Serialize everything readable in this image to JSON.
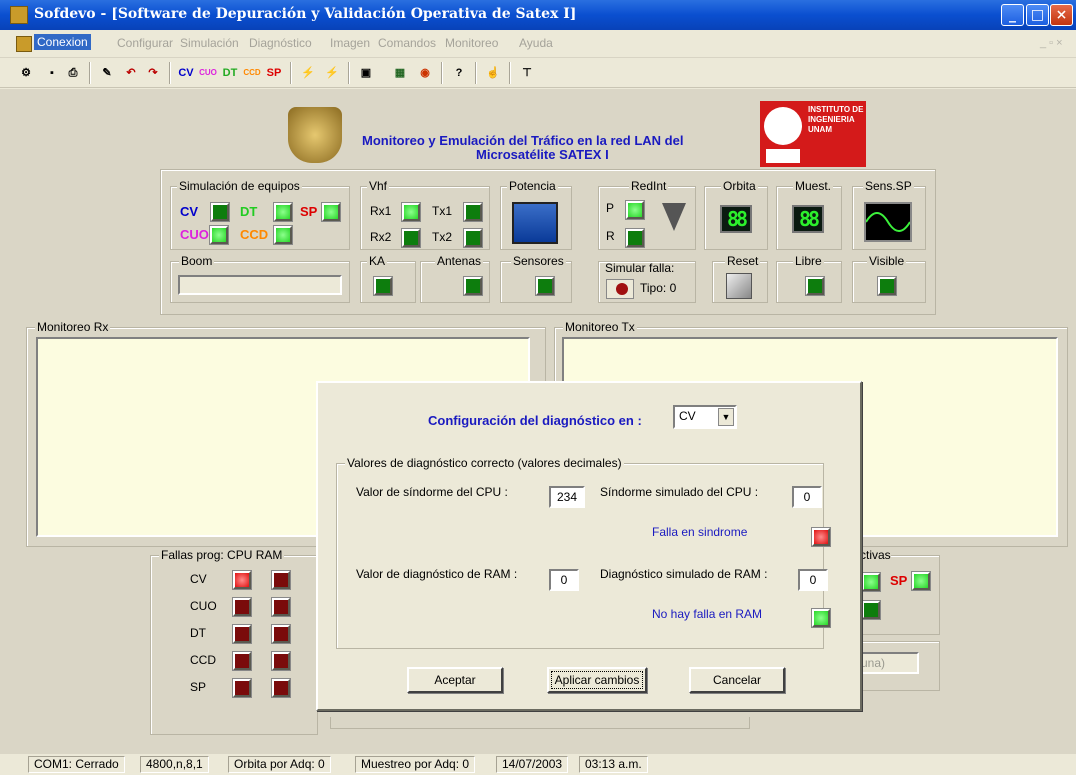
{
  "window": {
    "title": "Sofdevo - [Software de Depuración y Validación Operativa de Satex I]"
  },
  "menu": [
    "Conexion",
    "Configurar",
    "Simulación",
    "Diagnóstico",
    "Imagen",
    "Comandos",
    "Monitoreo",
    "Ayuda"
  ],
  "toolbar": {
    "cv": "CV",
    "cuo": "CUO",
    "dt": "DT",
    "ccd": "CCD",
    "sp": "SP"
  },
  "header": {
    "line1": "Monitoreo y Emulación del Tráfico en la red LAN del",
    "line2": "Microsatélite SATEX I",
    "logo_right": "INSTITUTO DE INGENIERIA UNAM"
  },
  "sim": {
    "label": "Simulación de equipos",
    "items": [
      "CV",
      "DT",
      "SP",
      "CUO",
      "CCD"
    ],
    "colors": {
      "CV": "#0000cc",
      "DT": "#22cc22",
      "SP": "#dd0000",
      "CUO": "#dd22dd",
      "CCD": "#ff8800"
    }
  },
  "vhf": {
    "label": "Vhf",
    "rx1": "Rx1",
    "tx1": "Tx1",
    "rx2": "Rx2",
    "tx2": "Tx2"
  },
  "potencia": {
    "label": "Potencia"
  },
  "redint": {
    "label": "RedInt",
    "p": "P",
    "r": "R"
  },
  "orbita": {
    "label": "Orbita",
    "display": "88"
  },
  "muest": {
    "label": "Muest.",
    "display": "88"
  },
  "sens": {
    "label": "Sens.SP"
  },
  "boom": {
    "label": "Boom"
  },
  "ka": {
    "label": "KA"
  },
  "antenas": {
    "label": "Antenas"
  },
  "sensores": {
    "label": "Sensores"
  },
  "simfalla": {
    "label": "Simular falla:",
    "tipo": "Tipo: 0"
  },
  "reset": {
    "label": "Reset"
  },
  "libre": {
    "label": "Libre"
  },
  "visible": {
    "label": "Visible"
  },
  "monitor": {
    "rx": "Monitoreo Rx",
    "tx": "Monitoreo Tx"
  },
  "fallas": {
    "label": "Fallas prog: CPU  RAM",
    "rows": [
      "CV",
      "CUO",
      "DT",
      "CCD",
      "SP"
    ]
  },
  "right_partial": {
    "label": "ctivas",
    "sp": "SP",
    "placeholder": "una)"
  },
  "dialog": {
    "title": "Configuración del diagnóstico en :",
    "select": "CV",
    "group": "Valores de diagnóstico correcto (valores decimales)",
    "cpu_label": "Valor de síndorme del CPU :",
    "cpu_value": "234",
    "cpu_sim_label": "Síndorme simulado del CPU :",
    "cpu_sim_value": "0",
    "sindrome_status": "Falla en sindrome",
    "ram_label": "Valor de diagnóstico de RAM :",
    "ram_value": "0",
    "ram_sim_label": "Diagnóstico simulado de RAM :",
    "ram_sim_value": "0",
    "ram_status": "No hay falla en RAM",
    "btn_ok": "Aceptar",
    "btn_apply": "Aplicar cambios",
    "btn_cancel": "Cancelar"
  },
  "status": [
    "COM1: Cerrado",
    "4800,n,8,1",
    "Orbita por Adq: 0",
    "Muestreo por Adq: 0",
    "14/07/2003",
    "03:13 a.m."
  ]
}
